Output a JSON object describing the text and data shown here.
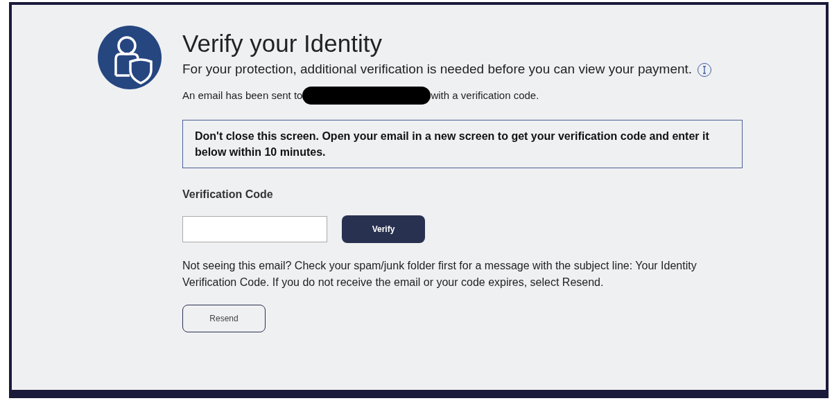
{
  "title": "Verify your Identity",
  "subtitle": "For your protection, additional verification is needed before you can view your payment.",
  "email_notice": {
    "before": "An email has been sent to",
    "after": "with a verification code.",
    "redacted": true
  },
  "warning": "Don't close this screen. Open your email in a new screen to get your verification code and enter it below within 10 minutes.",
  "code_field": {
    "label": "Verification Code"
  },
  "verify_button": "Verify",
  "help_text": "Not seeing this email? Check your spam/junk folder first for a message with the subject line: Your Identity Verification Code. If you do not receive the email or your code expires, select Resend.",
  "resend_button": "Resend"
}
